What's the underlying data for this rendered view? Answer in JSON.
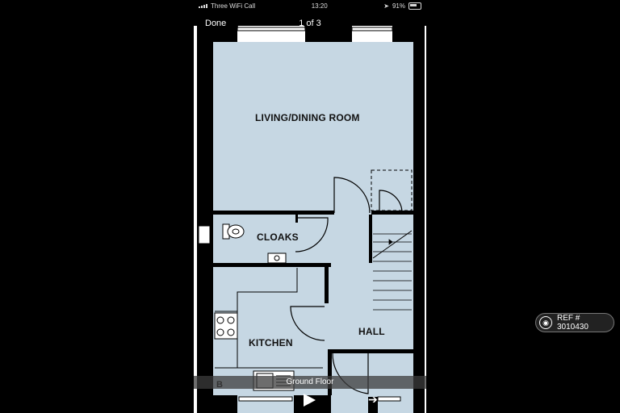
{
  "status_bar": {
    "carrier": "Three WiFi Call",
    "time": "13:20",
    "battery": "91%"
  },
  "nav": {
    "done_label": "Done",
    "counter": "1 of 3"
  },
  "floorplan": {
    "rooms": {
      "living": "LIVING/DINING ROOM",
      "cloaks": "CLOAKS",
      "kitchen": "KITCHEN",
      "hall": "HALL",
      "boiler": "B"
    },
    "caption": "Ground Floor",
    "colors": {
      "floor": "#c6d7e3",
      "wall": "#000000",
      "background": "#ffffff"
    }
  },
  "ref_badge": {
    "text": "REF # 3010430"
  }
}
